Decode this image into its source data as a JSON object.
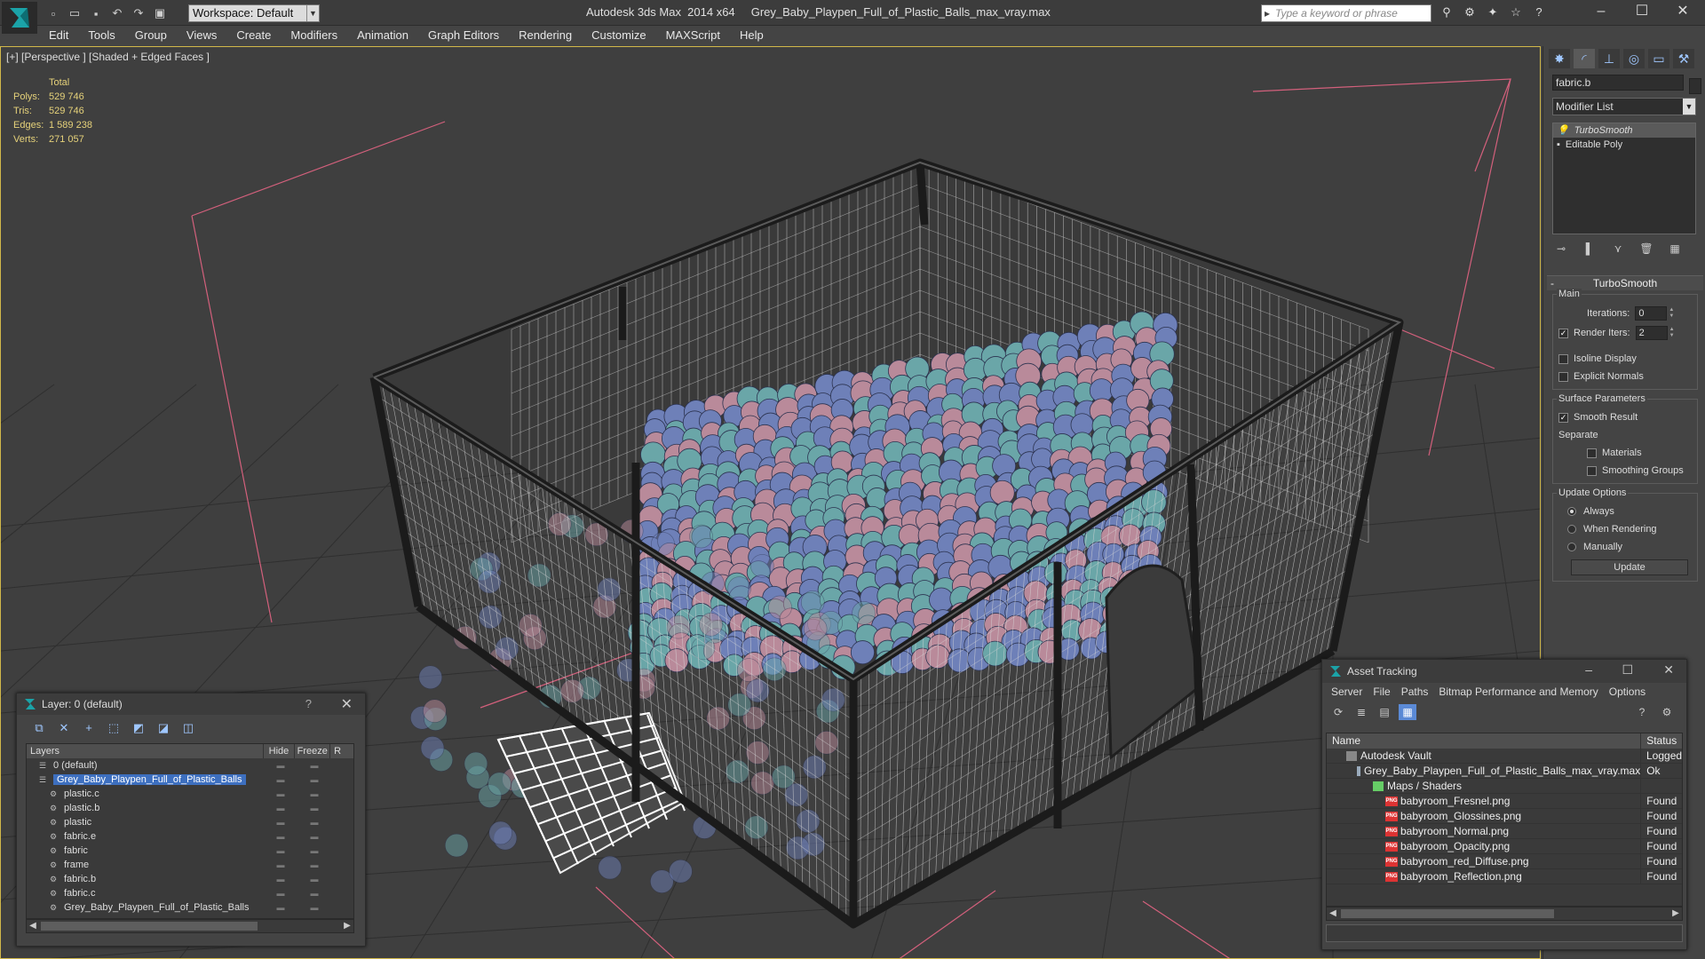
{
  "titlebar": {
    "app_title": "Autodesk 3ds Max  2014 x64     Grey_Baby_Playpen_Full_of_Plastic_Balls_max_vray.max",
    "workspace": "Workspace: Default",
    "search_placeholder": "Type a keyword or phrase"
  },
  "menu": [
    "Edit",
    "Tools",
    "Group",
    "Views",
    "Create",
    "Modifiers",
    "Animation",
    "Graph Editors",
    "Rendering",
    "Customize",
    "MAXScript",
    "Help"
  ],
  "viewport": {
    "label": "[+] [Perspective ] [Shaded + Edged Faces ]",
    "stats": {
      "header": "Total",
      "rows": [
        {
          "key": "Polys:",
          "value": "529 746"
        },
        {
          "key": "Tris:",
          "value": "529 746"
        },
        {
          "key": "Edges:",
          "value": "1 589 238"
        },
        {
          "key": "Verts:",
          "value": "271 057"
        }
      ]
    }
  },
  "command_panel": {
    "object_name": "fabric.b",
    "modifier_list": "Modifier List",
    "stack": [
      "TurboSmooth",
      "Editable Poly"
    ],
    "rollout": "TurboSmooth",
    "main_group": "Main",
    "iterations_label": "Iterations:",
    "iterations_value": "0",
    "render_iters_label": "Render Iters:",
    "render_iters_value": "2",
    "isoline": "Isoline Display",
    "explicit_normals": "Explicit Normals",
    "surface_group": "Surface Parameters",
    "smooth_result": "Smooth Result",
    "separate": "Separate",
    "materials": "Materials",
    "smoothing_groups": "Smoothing Groups",
    "update_group": "Update Options",
    "always": "Always",
    "when_rendering": "When Rendering",
    "manually": "Manually",
    "update_button": "Update"
  },
  "layer_panel": {
    "title": "Layer: 0 (default)",
    "help": "?",
    "columns": {
      "layers": "Layers",
      "hide": "Hide",
      "freeze": "Freeze",
      "render": "R"
    },
    "rows": [
      {
        "name": "0 (default)",
        "level": 0
      },
      {
        "name": "Grey_Baby_Playpen_Full_of_Plastic_Balls",
        "level": 0,
        "selected": true
      },
      {
        "name": "plastic.c",
        "level": 1
      },
      {
        "name": "plastic.b",
        "level": 1
      },
      {
        "name": "plastic",
        "level": 1
      },
      {
        "name": "fabric.e",
        "level": 1
      },
      {
        "name": "fabric",
        "level": 1
      },
      {
        "name": "frame",
        "level": 1
      },
      {
        "name": "fabric.b",
        "level": 1
      },
      {
        "name": "fabric.c",
        "level": 1
      },
      {
        "name": "Grey_Baby_Playpen_Full_of_Plastic_Balls",
        "level": 1
      }
    ]
  },
  "asset_tracking": {
    "title": "Asset Tracking",
    "menu": [
      "Server",
      "File",
      "Paths",
      "Bitmap Performance and Memory",
      "Options"
    ],
    "columns": {
      "name": "Name",
      "status": "Status"
    },
    "rows": [
      {
        "name": "Autodesk Vault",
        "status": "Logged",
        "level": 0,
        "type": "vault"
      },
      {
        "name": "Grey_Baby_Playpen_Full_of_Plastic_Balls_max_vray.max",
        "status": "Ok",
        "level": 1,
        "type": "max"
      },
      {
        "name": "Maps / Shaders",
        "status": "",
        "level": 2,
        "type": "folder"
      },
      {
        "name": "babyroom_Fresnel.png",
        "status": "Found",
        "level": 3,
        "type": "png"
      },
      {
        "name": "babyroom_Glossines.png",
        "status": "Found",
        "level": 3,
        "type": "png"
      },
      {
        "name": "babyroom_Normal.png",
        "status": "Found",
        "level": 3,
        "type": "png"
      },
      {
        "name": "babyroom_Opacity.png",
        "status": "Found",
        "level": 3,
        "type": "png"
      },
      {
        "name": "babyroom_red_Diffuse.png",
        "status": "Found",
        "level": 3,
        "type": "png"
      },
      {
        "name": "babyroom_Reflection.png",
        "status": "Found",
        "level": 3,
        "type": "png"
      }
    ]
  },
  "colors": {
    "viewport_border": "#d1b84a",
    "stats_text": "#e6d27a",
    "selection": "#3d6fbf",
    "ball_blue": "#6e80b8",
    "ball_pink": "#b98a9a",
    "ball_teal": "#6aa6a8"
  }
}
